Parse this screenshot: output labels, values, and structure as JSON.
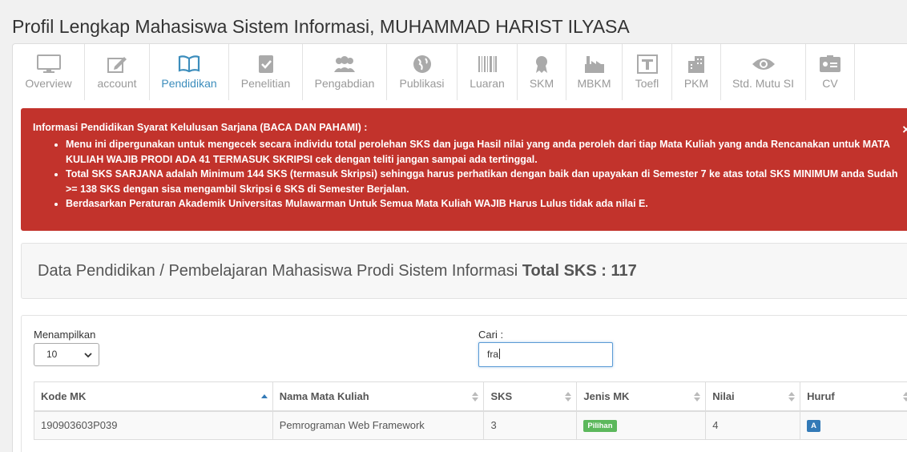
{
  "page_title": "Profil Lengkap Mahasiswa Sistem Informasi, MUHAMMAD HARIST ILYASA",
  "tabs": [
    {
      "label": "Overview",
      "icon": "monitor-icon"
    },
    {
      "label": "account",
      "icon": "edit-icon"
    },
    {
      "label": "Pendidikan",
      "icon": "book-icon",
      "active": true
    },
    {
      "label": "Penelitian",
      "icon": "checklist-icon"
    },
    {
      "label": "Pengabdian",
      "icon": "users-icon"
    },
    {
      "label": "Publikasi",
      "icon": "globe-icon"
    },
    {
      "label": "Luaran",
      "icon": "barcode-icon"
    },
    {
      "label": "SKM",
      "icon": "certificate-icon"
    },
    {
      "label": "MBKM",
      "icon": "industry-icon"
    },
    {
      "label": "Toefl",
      "icon": "text-t-icon"
    },
    {
      "label": "PKM",
      "icon": "building-icon"
    },
    {
      "label": "Std. Mutu SI",
      "icon": "eye-icon"
    },
    {
      "label": "CV",
      "icon": "id-card-icon"
    }
  ],
  "alert": {
    "heading": "Informasi Pendidikan Syarat Kelulusan Sarjana (BACA DAN PAHAMI) :",
    "items": [
      "Menu ini dipergunakan untuk mengecek secara individu total perolehan SKS dan juga Hasil nilai yang anda peroleh dari tiap Mata Kuliah yang anda Rencanakan untuk MATA KULIAH WAJIB PRODI ADA 41 TERMASUK SKRIPSI cek dengan teliti jangan sampai ada tertinggal.",
      "Total SKS SARJANA adalah Minimum 144 SKS (termasuk Skripsi) sehingga harus perhatikan dengan baik dan upayakan di Semester 7 ke atas total SKS MINIMUM anda Sudah >= 138 SKS dengan sisa mengambil Skripsi 6 SKS di Semester Berjalan.",
      "Berdasarkan Peraturan Akademik Universitas Mulawarman Untuk Semua Mata Kuliah WAJIB Harus Lulus tidak ada nilai E."
    ],
    "close": "×"
  },
  "summary": {
    "text": "Data Pendidikan / Pembelajaran Mahasiswa Prodi Sistem Informasi ",
    "total_label": "Total SKS : 117"
  },
  "controls": {
    "show_label": "Menampilkan",
    "show_value": "10",
    "search_label": "Cari :",
    "search_value": "fra"
  },
  "table": {
    "headers": [
      "Kode MK",
      "Nama Mata Kuliah",
      "SKS",
      "Jenis MK",
      "Nilai",
      "Huruf"
    ],
    "rows": [
      {
        "kode": "190903603P039",
        "nama": "Pemrograman Web Framework",
        "sks": "3",
        "jenis": "Pilihan",
        "nilai": "4",
        "huruf": "A"
      }
    ]
  },
  "colors": {
    "alert_bg": "#c2332c",
    "active_tab": "#3c8dbc",
    "badge_pilihan": "#5cb85c",
    "badge_a": "#337ab7"
  }
}
